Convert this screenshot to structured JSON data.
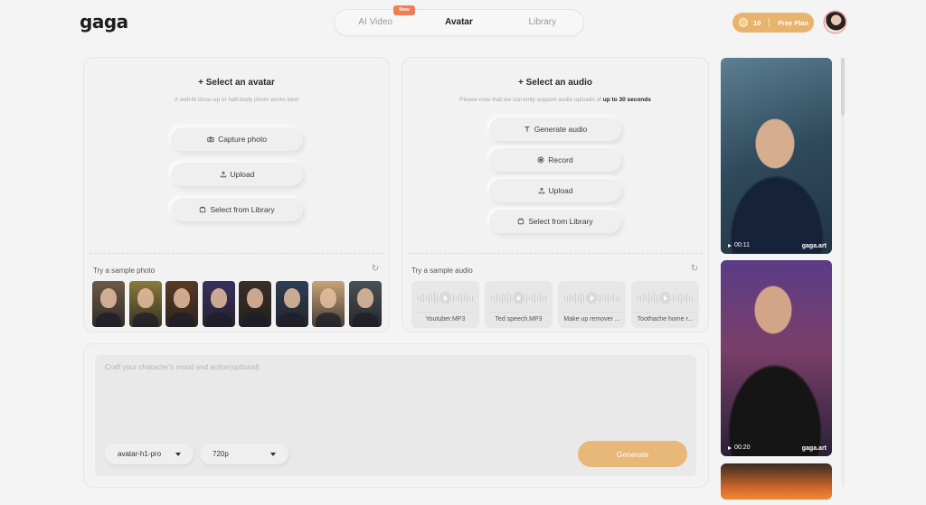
{
  "header": {
    "logo": "gaga",
    "tabs": [
      {
        "label": "AI Video",
        "badge": "New"
      },
      {
        "label": "Avatar",
        "active": true
      },
      {
        "label": "Library"
      }
    ],
    "credits": "10",
    "plan": "Free Plan"
  },
  "avatar_panel": {
    "title": "+ Select an avatar",
    "subtitle": "A well-lit close-up or half-body photo works best",
    "buttons": {
      "capture": "Capture photo",
      "upload": "Upload",
      "library": "Select from Library"
    },
    "sample_label": "Try a sample photo",
    "sample_colors": [
      "#6b5a48",
      "#8a7a3a",
      "#5a3a24",
      "#3b2f5e",
      "#3a2e28",
      "#2d3e55",
      "#c9a37a",
      "#4a5058"
    ]
  },
  "audio_panel": {
    "title": "+ Select an audio",
    "subtitle_prefix": "Please note that we currently support audio uploads of ",
    "subtitle_bold": "up to 30 seconds",
    "buttons": {
      "generate": "Generate audio",
      "record": "Record",
      "upload": "Upload",
      "library": "Select from Library"
    },
    "sample_label": "Try a sample audio",
    "samples": [
      "Youtuber.MP3",
      "Ted speech.MP3",
      "Make up remover ...",
      "Toothache home r..."
    ]
  },
  "prompt": {
    "placeholder": "Craft your character's mood and action(optional)",
    "model": "avatar-h1-pro",
    "resolution": "720p",
    "generate_label": "Generate"
  },
  "gallery": [
    {
      "duration": "00:11",
      "brand": "gaga.art"
    },
    {
      "duration": "00:20",
      "brand": "gaga.art"
    }
  ],
  "colors": {
    "accent": "#e8b878",
    "badge": "#ef7e55"
  }
}
